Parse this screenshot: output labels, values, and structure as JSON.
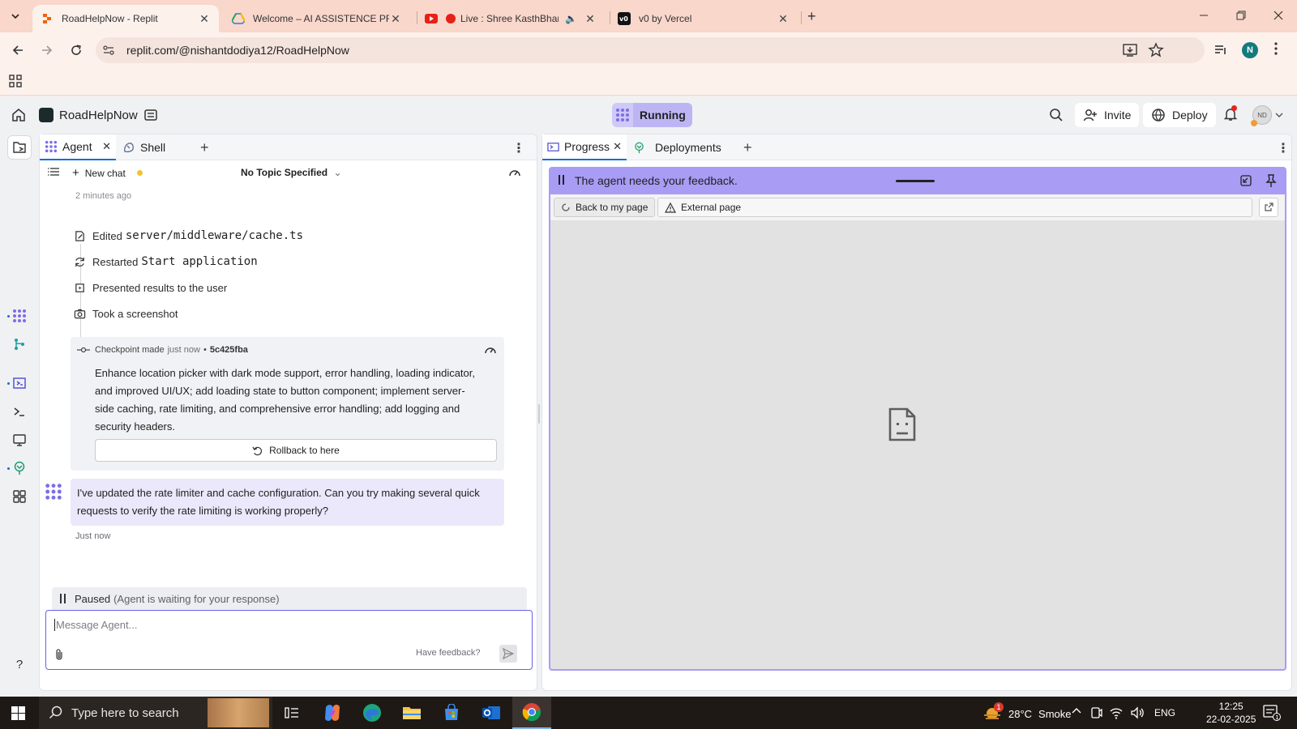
{
  "browser": {
    "tabs": [
      {
        "title": "RoadHelpNow - Replit",
        "active": true
      },
      {
        "title": "Welcome – AI ASSISTENCE PRO",
        "active": false
      },
      {
        "title": "Live : Shree KasthBhanja",
        "active": false
      },
      {
        "title": "v0 by Vercel",
        "active": false
      }
    ],
    "url": "replit.com/@nishantdodiya12/RoadHelpNow",
    "profile_initial": "N"
  },
  "app": {
    "repl_name": "RoadHelpNow",
    "status": "Running",
    "invite_label": "Invite",
    "deploy_label": "Deploy",
    "avatar_initials": "ND"
  },
  "left_pane": {
    "tabs": [
      {
        "label": "Agent"
      },
      {
        "label": "Shell"
      }
    ],
    "new_chat_label": "New chat",
    "topic": "No Topic Specified",
    "time_ago": "2 minutes ago",
    "actions": [
      {
        "label": "Edited",
        "code": "server/middleware/cache.ts"
      },
      {
        "label": "Restarted",
        "code": "Start application"
      },
      {
        "label": "Presented results to the user",
        "code": ""
      },
      {
        "label": "Took a screenshot",
        "code": ""
      }
    ],
    "checkpoint": {
      "label": "Checkpoint made",
      "when": "just now",
      "hash": "5c425fba",
      "description": "Enhance location picker with dark mode support, error handling, loading indicator, and improved UI/UX; add loading state to button component; implement server-side caching, rate limiting, and comprehensive error handling; add logging and security headers.",
      "rollback_label": "Rollback to here"
    },
    "agent_message": "I've updated the rate limiter and cache configuration. Can you try making several quick requests to verify the rate limiting is working properly?",
    "message_time": "Just now",
    "paused_label": "Paused",
    "paused_detail": "(Agent is waiting for your response)",
    "composer_placeholder": "Message Agent...",
    "feedback_label": "Have feedback?"
  },
  "right_pane": {
    "tabs": [
      {
        "label": "Progress"
      },
      {
        "label": "Deployments"
      }
    ],
    "feedback_banner": "The agent needs your feedback.",
    "back_label": "Back to my page",
    "external_label": "External page"
  },
  "taskbar": {
    "search_placeholder": "Type here to search",
    "weather_temp": "28°C",
    "weather_desc": "Smoke",
    "weather_badge": "1",
    "language": "ENG",
    "time": "12:25",
    "date": "22-02-2025",
    "notification_count": "1"
  },
  "colors": {
    "accent": "#6d5fe8",
    "feedback_banner": "#a99cf5",
    "running_pill": "#cfc9f7",
    "agent_bubble": "#ebe8fb"
  }
}
